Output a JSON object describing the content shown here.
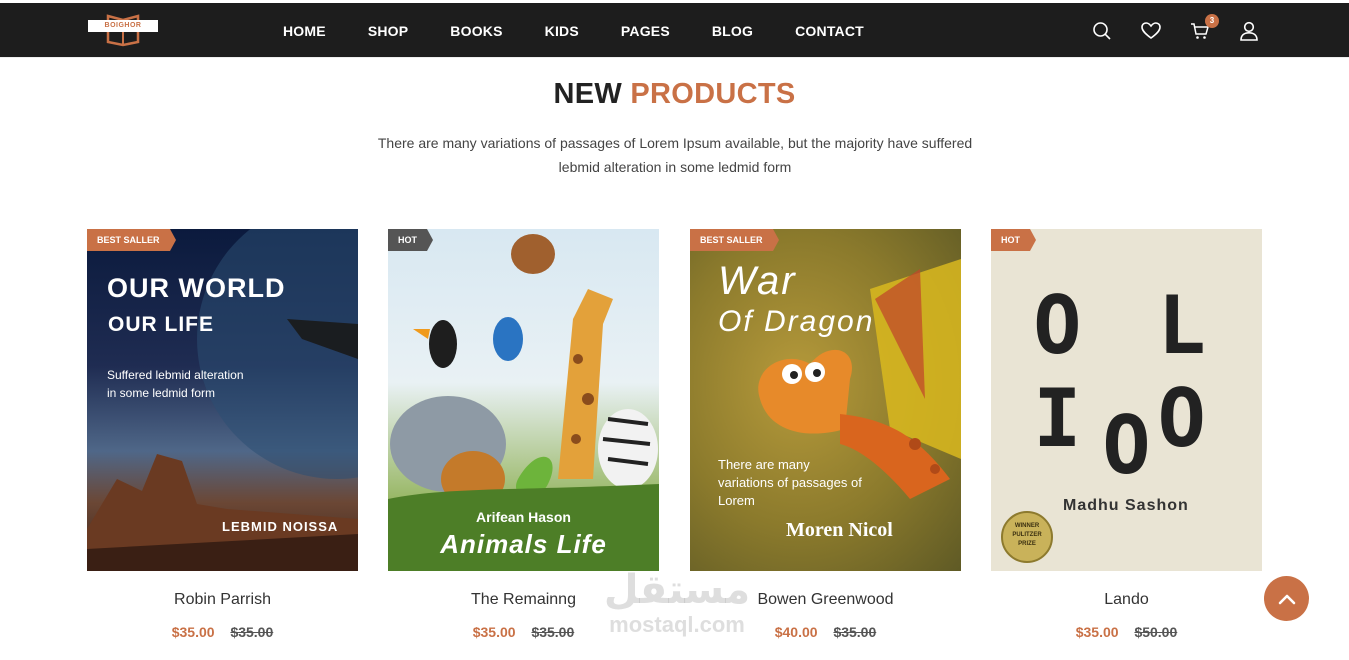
{
  "brand": {
    "logo_text": "BOIGHOR",
    "accent_color": "#c97146",
    "header_bg": "#1d1d1d"
  },
  "nav": {
    "items": [
      "HOME",
      "SHOP",
      "BOOKS",
      "KIDS",
      "PAGES",
      "BLOG",
      "CONTACT"
    ]
  },
  "header_icons": {
    "search": "search-icon",
    "wishlist": "heart-icon",
    "cart": "cart-icon",
    "cart_count": "3",
    "account": "user-icon"
  },
  "section": {
    "title_part1": "NEW",
    "title_part2": "PRODUCTS",
    "description": "There are many variations of passages of Lorem Ipsum available, but the majority have suffered lebmid alteration in some ledmid form"
  },
  "products": [
    {
      "tag": "BEST SALLER",
      "name": "Robin Parrish",
      "price": "$35.00",
      "old_price": "$35.00",
      "cover": {
        "line1": "OUR WORLD",
        "line2": "OUR LIFE",
        "line3": "Suffered lebmid alteration",
        "line4": "in some ledmid form",
        "author": "LEBMID NOISSA"
      }
    },
    {
      "tag": "HOT",
      "name": "The Remainng",
      "price": "$35.00",
      "old_price": "$35.00",
      "cover": {
        "author": "Arifean Hason",
        "title": "Animals Life"
      }
    },
    {
      "tag": "BEST SALLER",
      "name": "Bowen Greenwood",
      "price": "$40.00",
      "old_price": "$35.00",
      "cover": {
        "line1": "War",
        "line2": "Of Dragon",
        "line3": "There are many",
        "line4": "variations of passages of",
        "line5": "Lorem",
        "author": "Moren Nicol"
      }
    },
    {
      "tag": "HOT",
      "name": "Lando",
      "price": "$35.00",
      "old_price": "$50.00",
      "cover": {
        "row1": "O L I O",
        "row2": "O",
        "author": "Madhu Sashon",
        "seal_line1": "WINNER",
        "seal_line2": "PULITZER",
        "seal_line3": "PRIZE"
      }
    }
  ],
  "watermark": {
    "arabic": "مستقل",
    "latin": "mostaql.com"
  },
  "scroll_top": "chevron-up-icon"
}
